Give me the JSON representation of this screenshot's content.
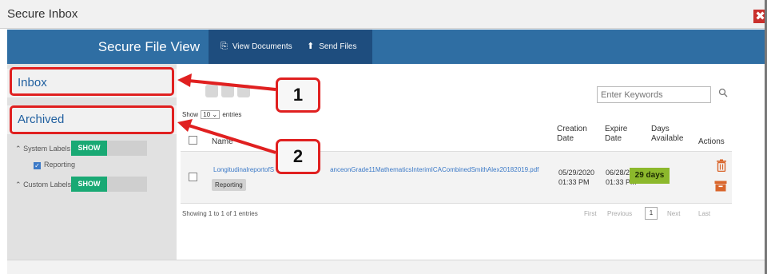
{
  "window": {
    "title": "Secure Inbox",
    "close_glyph": "✖"
  },
  "header": {
    "brand": "Secure File View",
    "nav": [
      {
        "label": "View Documents",
        "icon": "documents-icon"
      },
      {
        "label": "Send Files",
        "icon": "upload-icon"
      }
    ]
  },
  "sidebar": {
    "inbox": "Inbox",
    "archived": "Archived",
    "system_labels": {
      "label": "System Labels",
      "toggle": "SHOW",
      "items": [
        "Reporting"
      ]
    },
    "custom_labels": {
      "label": "Custom Labels",
      "toggle": "SHOW"
    }
  },
  "main": {
    "search_placeholder": "Enter Keywords",
    "show_prefix": "Show",
    "entries_value": "10",
    "show_suffix": "entries",
    "columns": {
      "name": "Name",
      "creation": [
        "Creation",
        "Date"
      ],
      "expire": [
        "Expire",
        "Date"
      ],
      "days": [
        "Days",
        "Available"
      ],
      "actions": "Actions"
    },
    "rows": [
      {
        "file_left": "LongitudinalreportofS",
        "file_right": "anceonGrade11MathematicsInterimICACombinedSmithAlex20182019.pdf",
        "tag": "Reporting",
        "creation_date": "05/29/2020",
        "creation_time": "01:33 PM",
        "expire_date": "06/28/2020",
        "expire_time": "01:33 PM",
        "days": "29 days"
      }
    ],
    "footer_info": "Showing 1 to 1 of 1 entries",
    "pagination": {
      "first": "First",
      "previous": "Previous",
      "current": "1",
      "next": "Next",
      "last": "Last"
    }
  },
  "callouts": [
    "1",
    "2"
  ],
  "colors": {
    "header_blue": "#2f6ea3",
    "nav_dark": "#1e4d7e",
    "toggle_green": "#19a974",
    "badge_green": "#8cb82c",
    "callout_red": "#e02020",
    "action_orange": "#d9652b"
  }
}
